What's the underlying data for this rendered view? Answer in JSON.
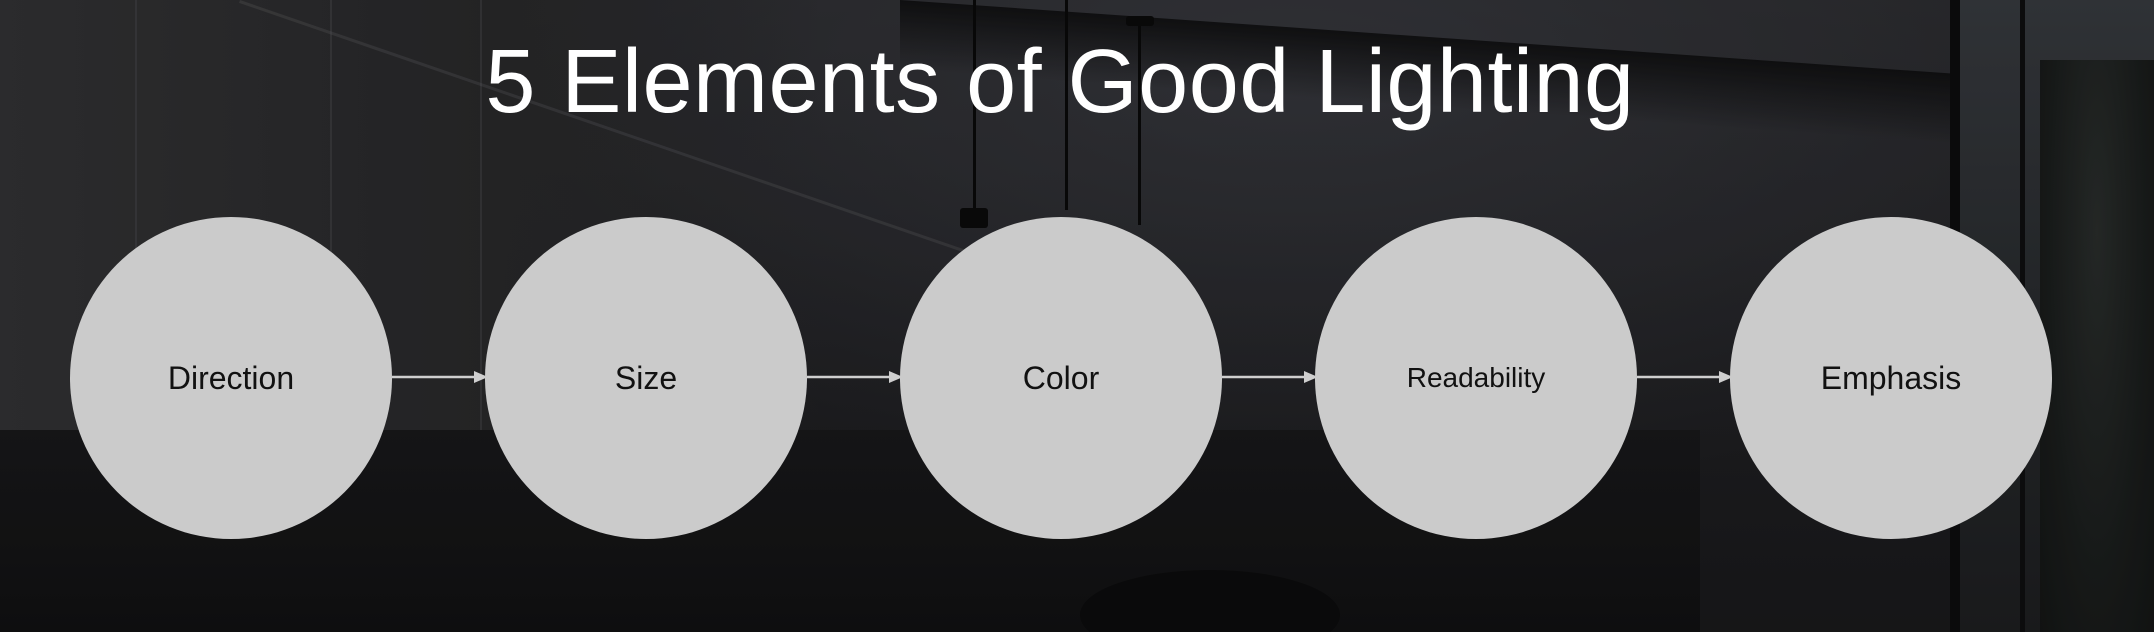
{
  "slide": {
    "title": "5 Elements of Good Lighting"
  },
  "diagram": {
    "type": "flow",
    "nodes": [
      {
        "id": "direction",
        "label": "Direction"
      },
      {
        "id": "size",
        "label": "Size"
      },
      {
        "id": "color",
        "label": "Color"
      },
      {
        "id": "readability",
        "label": "Readability"
      },
      {
        "id": "emphasis",
        "label": "Emphasis"
      }
    ],
    "edges": [
      {
        "from": "direction",
        "to": "size"
      },
      {
        "from": "size",
        "to": "color"
      },
      {
        "from": "color",
        "to": "readability"
      },
      {
        "from": "readability",
        "to": "emphasis"
      }
    ]
  },
  "colors": {
    "node_fill": "#cbcbcb",
    "node_text": "#111111",
    "title_text": "#ffffff",
    "connector": "#cfcfcf"
  },
  "icons": {
    "connector": "arrow-right-icon"
  }
}
